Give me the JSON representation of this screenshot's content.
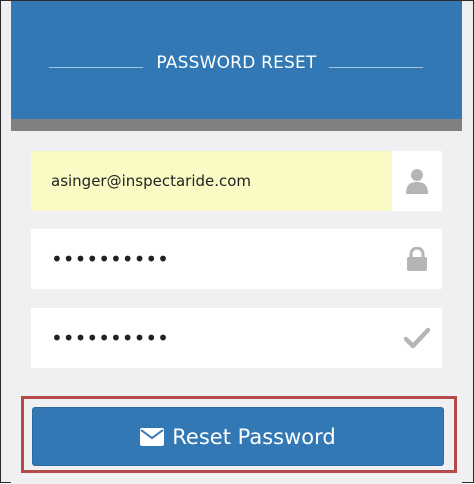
{
  "header": {
    "title": "PASSWORD RESET"
  },
  "form": {
    "email": {
      "value": "asinger@inspectaride.com",
      "icon": "user-icon"
    },
    "password": {
      "value": "••••••••••",
      "icon": "lock-icon"
    },
    "confirm_password": {
      "value": "••••••••••",
      "icon": "check-icon"
    }
  },
  "submit": {
    "label": "Reset Password",
    "icon": "envelope-icon"
  },
  "colors": {
    "primary": "#3178b5",
    "header_bar": "#808080",
    "autofill": "#fafbc4",
    "highlight_border": "#b54a4a",
    "icon_gray": "#b5b5b5"
  }
}
